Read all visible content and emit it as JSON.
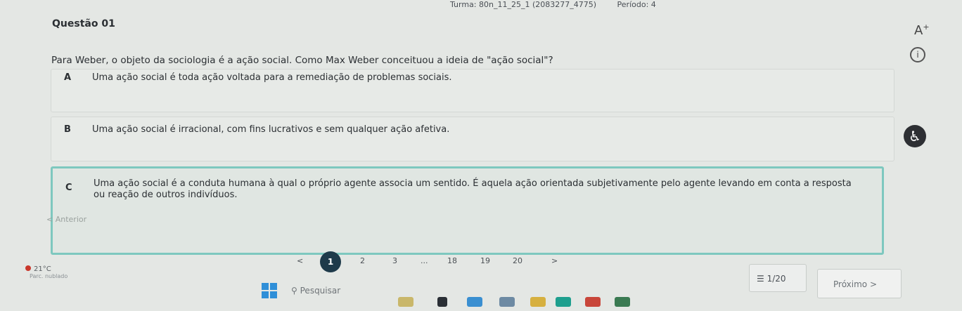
{
  "header": {
    "turma": "Turma: 80n_11_25_1 (2083277_4775)",
    "periodo": "Período: 4"
  },
  "question": {
    "title": "Questão 01",
    "text": "Para Weber, o objeto da sociologia é a ação social. Como Max Weber conceituou a ideia de \"ação social\"?"
  },
  "options": [
    {
      "letter": "A",
      "text": "Uma ação social é toda ação voltada para a remediação de problemas sociais."
    },
    {
      "letter": "B",
      "text": "Uma ação social é irracional, com fins lucrativos e sem qualquer ação afetiva."
    },
    {
      "letter": "C",
      "text": "Uma ação social é a conduta humana à qual o próprio agente associa um sentido. É aquela ação orientada subjetivamente pelo agente levando em conta a resposta ou reação de outros indivíduos."
    }
  ],
  "selected_option": "C",
  "side_icons": {
    "font_size": "A",
    "font_size_plus": "+",
    "info": "i"
  },
  "nav": {
    "prev_label": "< Anterior",
    "pages": [
      "<",
      "1",
      "2",
      "3",
      "...",
      "18",
      "19",
      "20",
      ">"
    ],
    "current_page": "1",
    "counter": "☰ 1/20",
    "next_label": "Próximo >"
  },
  "taskbar": {
    "weather_temp": "21°C",
    "weather_desc": "Parc. nublado",
    "search_placeholder": "Pesquisar"
  }
}
